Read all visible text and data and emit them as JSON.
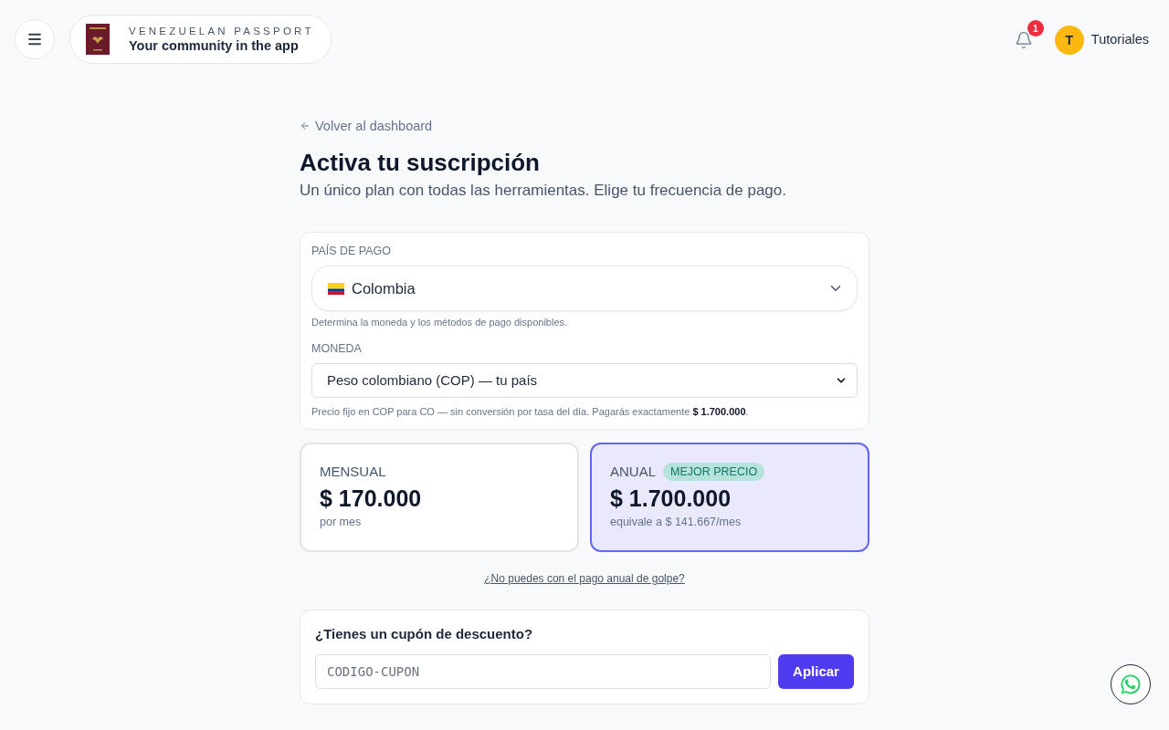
{
  "header": {
    "brand": {
      "title": "VENEZUELAN PASSPORT",
      "tagline": "Your community in the app"
    },
    "notifications": {
      "count": "1"
    },
    "user": {
      "initial": "T",
      "name": "Tutoriales"
    }
  },
  "back_link": "Volver al dashboard",
  "title": "Activa tu suscripción",
  "subtitle": "Un único plan con todas las herramientas. Elige tu frecuencia de pago.",
  "payment_settings": {
    "country": {
      "label": "PAÍS DE PAGO",
      "value": "Colombia",
      "hint": "Determina la moneda y los métodos de pago disponibles."
    },
    "currency": {
      "label": "MONEDA",
      "value": "Peso colombiano (COP) — tu país",
      "note": "Precio fijo en COP para CO — sin conversión por tasa del día. Pagarás exactamente **$ 1.700.000**."
    }
  },
  "plans": [
    {
      "name": "MENSUAL",
      "price": "$ 170.000",
      "detail": "por mes",
      "selected": false
    },
    {
      "name": "ANUAL",
      "badge": "MEJOR PRECIO",
      "price": "$ 1.700.000",
      "detail": "equivale a $ 141.667/mes",
      "selected": true
    }
  ],
  "installments_link": "¿No puedes con el pago anual de golpe?",
  "coupon": {
    "title": "¿Tienes un cupón de descuento?",
    "placeholder": "CODIGO-CUPON",
    "button": "Aplicar"
  }
}
